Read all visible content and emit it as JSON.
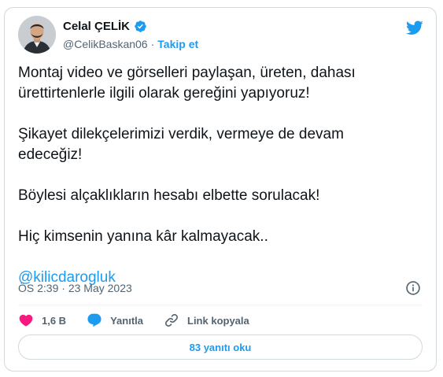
{
  "author": {
    "display_name": "Celal ÇELİK",
    "handle": "@CelikBaskan06",
    "separator": "·",
    "follow_label": "Takip et"
  },
  "tweet": {
    "paragraphs": [
      "Montaj video ve görselleri paylaşan, üreten, dahası\nürettirtenlerle ilgili olarak gereğini yapıyoruz!",
      "Şikayet dilekçelerimizi verdik, vermeye de devam\nedeceğiz!",
      "Böylesi alçaklıkların hesabı elbette sorulacak!",
      "Hiç kimsenin yanına kâr kalmayacak.."
    ],
    "mention": "@kilicdarogluk"
  },
  "meta": {
    "time": "ÖS 2:39",
    "separator": "·",
    "date": "23 May 2023"
  },
  "actions": {
    "likes": "1,6 B",
    "reply_label": "Yanıtla",
    "copy_link_label": "Link kopyala"
  },
  "replies_button": "83 yanıtı oku",
  "colors": {
    "accent": "#1d9bf0",
    "like": "#f91880",
    "text": "#0f1419",
    "muted": "#536471",
    "border": "#cfd9de"
  },
  "icons": [
    "verified-badge-icon",
    "twitter-logo-icon",
    "info-icon",
    "heart-icon",
    "reply-bubble-icon",
    "link-icon"
  ]
}
